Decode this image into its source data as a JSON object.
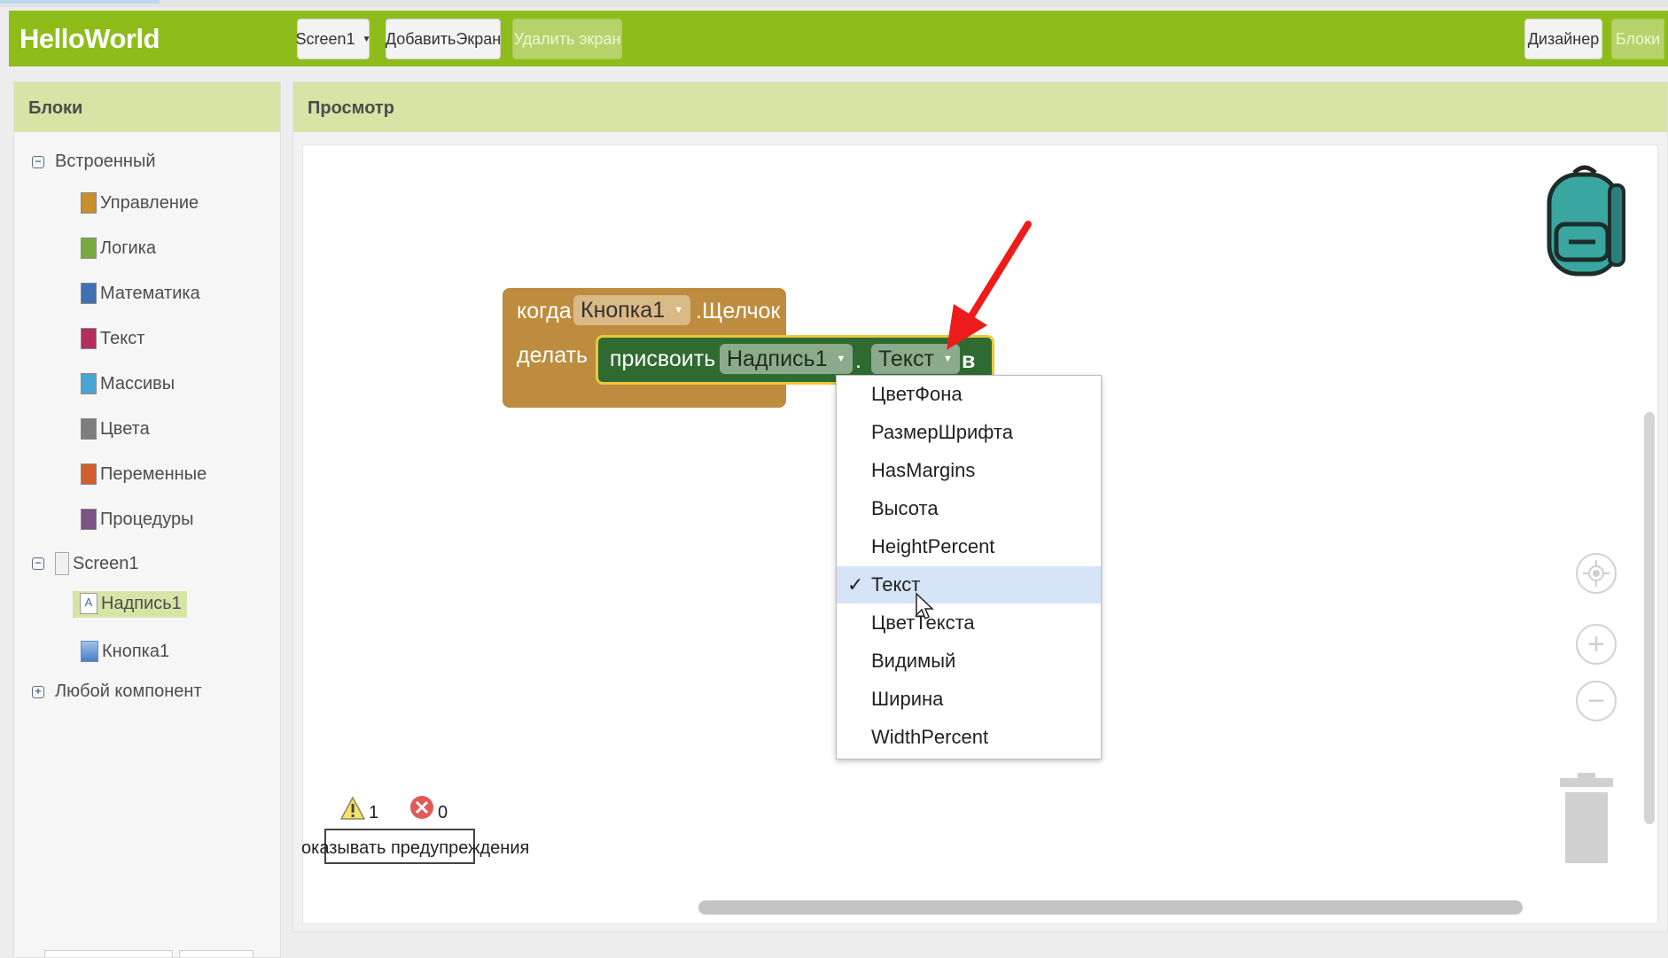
{
  "header": {
    "app_title": "HelloWorld",
    "screen_select": "Screen1",
    "add_screen": "ДобавитьЭкран",
    "remove_screen": "Удалить экран",
    "designer": "Дизайнер",
    "blocks": "Блоки"
  },
  "blocks_panel": {
    "title": "Блоки",
    "builtin": {
      "label": "Встроенный",
      "toggle": "−",
      "items": [
        {
          "label": "Управление",
          "color": "#c8902b"
        },
        {
          "label": "Логика",
          "color": "#77ab41"
        },
        {
          "label": "Математика",
          "color": "#3f71b5"
        },
        {
          "label": "Текст",
          "color": "#b32d5e"
        },
        {
          "label": "Массивы",
          "color": "#49a6d4"
        },
        {
          "label": "Цвета",
          "color": "#7d7d7d"
        },
        {
          "label": "Переменные",
          "color": "#d05f2d"
        },
        {
          "label": "Процедуры",
          "color": "#7c5385"
        }
      ]
    },
    "screen": {
      "label": "Screen1",
      "toggle": "−",
      "components": [
        "Надпись1",
        "Кнопка1"
      ]
    },
    "any_component": {
      "label": "Любой компонент",
      "toggle": "+"
    }
  },
  "viewer": {
    "title": "Просмотр",
    "event_block": {
      "when": "когда",
      "component": "Кнопка1",
      "event": ".Щелчок",
      "do": "делать"
    },
    "set_block": {
      "set": "присвоить",
      "component": "Надпись1",
      "dot": ".",
      "property": "Текст",
      "to": "в"
    },
    "dropdown": {
      "items": [
        "ЦветФона",
        "РазмерШрифта",
        "HasMargins",
        "Высота",
        "HeightPercent",
        "Текст",
        "ЦветТекста",
        "Видимый",
        "Ширина",
        "WidthPercent"
      ],
      "selected": "Текст",
      "check_mark": "✓"
    },
    "warnings": {
      "warning_count": "1",
      "error_count": "0",
      "toggle_label": "оказывать предупреждения"
    },
    "zoom": {
      "plus": "+",
      "minus": "−"
    }
  }
}
